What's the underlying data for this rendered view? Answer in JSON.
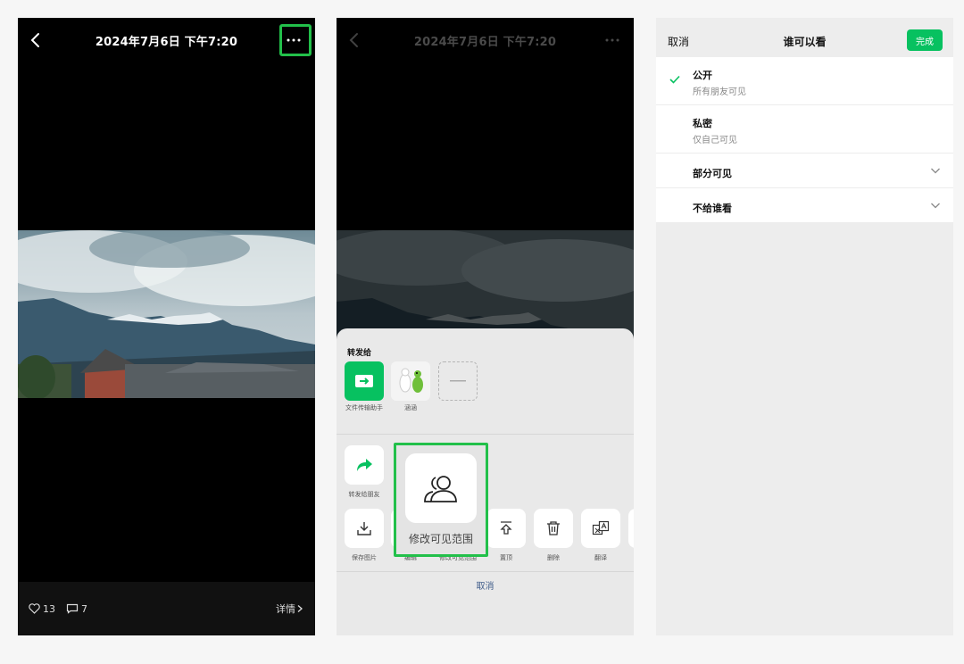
{
  "panel1": {
    "title": "2024年7月6日 下午7:20",
    "likes": "13",
    "comments": "7",
    "details": "详情"
  },
  "panel2": {
    "title": "2024年7月6日 下午7:20",
    "share_title": "转发给",
    "share_targets": [
      {
        "label": "文件传输助手"
      },
      {
        "label": "涵涵"
      }
    ],
    "actions_row1": [
      {
        "label": "转发给朋友"
      }
    ],
    "actions_row2": [
      {
        "label": "保存图片"
      },
      {
        "label": "编辑"
      },
      {
        "label": "修改可见范围"
      },
      {
        "label": "置顶"
      },
      {
        "label": "删除"
      },
      {
        "label": "翻译"
      }
    ],
    "cancel": "取消",
    "zoom_label": "修改可见范围"
  },
  "panel3": {
    "cancel": "取消",
    "title": "谁可以看",
    "done": "完成",
    "options": [
      {
        "name": "公开",
        "desc": "所有朋友可见",
        "selected": true
      },
      {
        "name": "私密",
        "desc": "仅自己可见"
      },
      {
        "name": "部分可见"
      },
      {
        "name": "不给谁看"
      }
    ]
  },
  "colors": {
    "accent_green": "#07c160",
    "highlight_green": "#22c04a",
    "link_blue": "#3f5c8a"
  }
}
